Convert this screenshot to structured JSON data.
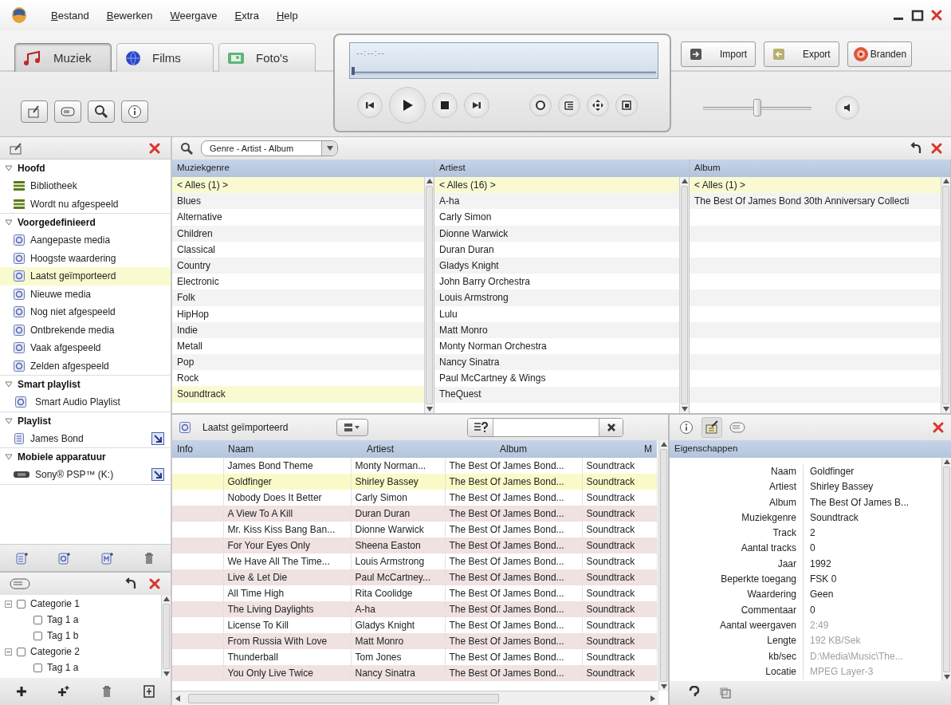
{
  "menu": [
    {
      "label": "Bestand"
    },
    {
      "label": "Bewerken"
    },
    {
      "label": "Weergave"
    },
    {
      "label": "Extra"
    },
    {
      "label": "Help"
    }
  ],
  "media_tabs": [
    {
      "label": "Muziek",
      "kind": "music",
      "selected": true
    },
    {
      "label": "Films",
      "kind": "film",
      "selected": false
    },
    {
      "label": "Foto's",
      "kind": "photo",
      "selected": false
    }
  ],
  "player": {
    "time": "--:--:--",
    "seek": {
      "level": 0
    },
    "volume": {
      "level": 0.5
    }
  },
  "actions": [
    {
      "label": "Import",
      "kind": "import"
    },
    {
      "label": "Export",
      "kind": "export"
    },
    {
      "label": "Branden",
      "kind": "burn"
    }
  ],
  "sidebar": {
    "sections": [
      {
        "title": "Hoofd",
        "items": [
          {
            "label": "Bibliotheek",
            "kind": "library",
            "selected": false
          },
          {
            "label": "Wordt nu afgespeeld",
            "kind": "library",
            "selected": false
          }
        ]
      },
      {
        "title": "Voorgedefinieerd",
        "items": [
          {
            "label": "Aangepaste media",
            "kind": "auto",
            "selected": false
          },
          {
            "label": "Hoogste waardering",
            "kind": "auto",
            "selected": false
          },
          {
            "label": "Laatst geïmporteerd",
            "kind": "auto",
            "selected": true
          },
          {
            "label": "Nieuwe media",
            "kind": "auto",
            "selected": false
          },
          {
            "label": "Nog niet afgespeeld",
            "kind": "auto",
            "selected": false
          },
          {
            "label": "Ontbrekende media",
            "kind": "auto",
            "selected": false
          },
          {
            "label": "Vaak afgespeeld",
            "kind": "auto",
            "selected": false
          },
          {
            "label": "Zelden afgespeeld",
            "kind": "auto",
            "selected": false
          }
        ]
      },
      {
        "title": "Smart playlist",
        "items": [
          {
            "label": "Smart Audio Playlist",
            "kind": "smart",
            "selected": false
          }
        ]
      },
      {
        "title": "Playlist",
        "items": [
          {
            "label": "James Bond",
            "kind": "playlist",
            "selected": false
          }
        ]
      },
      {
        "title": "Mobiele apparatuur",
        "items": [
          {
            "label": "Sony® PSP™ (K:)",
            "kind": "device",
            "selected": false
          }
        ]
      }
    ]
  },
  "tags": [
    {
      "label": "Categorie 1",
      "checked": false,
      "expanded": true,
      "children": [
        {
          "label": "Tag 1 a",
          "checked": false
        },
        {
          "label": "Tag 1 b",
          "checked": false
        }
      ]
    },
    {
      "label": "Categorie 2",
      "checked": false,
      "expanded": true,
      "children": [
        {
          "label": "Tag 1 a",
          "checked": false
        }
      ]
    }
  ],
  "browser": {
    "view": "Genre - Artist - Album",
    "columns": [
      {
        "title": "Muziekgenre",
        "items": [
          {
            "label": "< Alles (1) >",
            "selected": true
          },
          {
            "label": "Blues",
            "selected": false
          },
          {
            "label": "Alternative",
            "selected": false
          },
          {
            "label": "Children",
            "selected": false
          },
          {
            "label": "Classical",
            "selected": false
          },
          {
            "label": "Country",
            "selected": false
          },
          {
            "label": "Electronic",
            "selected": false
          },
          {
            "label": "Folk",
            "selected": false
          },
          {
            "label": "HipHop",
            "selected": false
          },
          {
            "label": "Indie",
            "selected": false
          },
          {
            "label": "Metall",
            "selected": false
          },
          {
            "label": "Pop",
            "selected": false
          },
          {
            "label": "Rock",
            "selected": false
          },
          {
            "label": "Soundtrack",
            "selected": true
          }
        ]
      },
      {
        "title": "Artiest",
        "items": [
          {
            "label": "< Alles (16) >",
            "selected": true
          },
          {
            "label": "A-ha",
            "selected": false
          },
          {
            "label": "Carly Simon",
            "selected": false
          },
          {
            "label": "Dionne Warwick",
            "selected": false
          },
          {
            "label": "Duran Duran",
            "selected": false
          },
          {
            "label": "Gladys Knight",
            "selected": false
          },
          {
            "label": "John Barry Orchestra",
            "selected": false
          },
          {
            "label": "Louis Armstrong",
            "selected": false
          },
          {
            "label": "Lulu",
            "selected": false
          },
          {
            "label": "Matt Monro",
            "selected": false
          },
          {
            "label": "Monty Norman Orchestra",
            "selected": false
          },
          {
            "label": "Nancy Sinatra",
            "selected": false
          },
          {
            "label": "Paul McCartney & Wings",
            "selected": false
          },
          {
            "label": "TheQuest",
            "selected": false
          }
        ]
      },
      {
        "title": "Album",
        "items": [
          {
            "label": "< Alles (1) >",
            "selected": true
          },
          {
            "label": "The Best Of James Bond 30th Anniversary Collecti",
            "selected": false
          }
        ]
      }
    ]
  },
  "playlist": {
    "title": "Laatst geïmporteerd",
    "columns": [
      "Info",
      "Naam",
      "Artiest",
      "Album",
      "M"
    ],
    "rows": [
      {
        "name": "James Bond Theme",
        "artist": "Monty Norman...",
        "album": "The Best Of James Bond...",
        "genre": "Soundtrack",
        "selected": false
      },
      {
        "name": "Goldfinger",
        "artist": "Shirley Bassey",
        "album": "The Best Of James Bond...",
        "genre": "Soundtrack",
        "selected": true
      },
      {
        "name": "Nobody Does It Better",
        "artist": "Carly Simon",
        "album": "The Best Of James Bond...",
        "genre": "Soundtrack",
        "selected": false
      },
      {
        "name": "A View To A Kill",
        "artist": "Duran Duran",
        "album": "The Best Of James Bond...",
        "genre": "Soundtrack",
        "selected": false
      },
      {
        "name": "Mr. Kiss Kiss Bang Ban...",
        "artist": "Dionne Warwick",
        "album": "The Best Of James Bond...",
        "genre": "Soundtrack",
        "selected": false
      },
      {
        "name": "For Your Eyes Only",
        "artist": "Sheena Easton",
        "album": "The Best Of James Bond...",
        "genre": "Soundtrack",
        "selected": false
      },
      {
        "name": "We Have All The Time...",
        "artist": "Louis Armstrong",
        "album": "The Best Of James Bond...",
        "genre": "Soundtrack",
        "selected": false
      },
      {
        "name": "Live & Let Die",
        "artist": "Paul McCartney...",
        "album": "The Best Of James Bond...",
        "genre": "Soundtrack",
        "selected": false
      },
      {
        "name": "All Time High",
        "artist": "Rita Coolidge",
        "album": "The Best Of James Bond...",
        "genre": "Soundtrack",
        "selected": false
      },
      {
        "name": "The Living Daylights",
        "artist": "A-ha",
        "album": "The Best Of James Bond...",
        "genre": "Soundtrack",
        "selected": false
      },
      {
        "name": "License To Kill",
        "artist": "Gladys Knight",
        "album": "The Best Of James Bond...",
        "genre": "Soundtrack",
        "selected": false
      },
      {
        "name": "From Russia With Love",
        "artist": "Matt Monro",
        "album": "The Best Of James Bond...",
        "genre": "Soundtrack",
        "selected": false
      },
      {
        "name": "Thunderball",
        "artist": "Tom Jones",
        "album": "The Best Of James Bond...",
        "genre": "Soundtrack",
        "selected": false
      },
      {
        "name": "You Only Live Twice",
        "artist": "Nancy Sinatra",
        "album": "The Best Of James Bond...",
        "genre": "Soundtrack",
        "selected": false
      }
    ]
  },
  "properties": {
    "tabs": [
      {
        "kind": "info",
        "selected": false
      },
      {
        "kind": "edit",
        "selected": true
      },
      {
        "kind": "tag",
        "selected": false
      }
    ],
    "title": "Eigenschappen",
    "fields": [
      {
        "label": "Naam",
        "value": "Goldfinger",
        "disabled": false
      },
      {
        "label": "Artiest",
        "value": "Shirley Bassey",
        "disabled": false
      },
      {
        "label": "Album",
        "value": "The Best Of James B...",
        "disabled": false
      },
      {
        "label": "Muziekgenre",
        "value": "Soundtrack",
        "disabled": false
      },
      {
        "label": "Track",
        "value": "2",
        "disabled": false
      },
      {
        "label": "Aantal tracks",
        "value": "0",
        "disabled": false
      },
      {
        "label": "Jaar",
        "value": "1992",
        "disabled": false
      },
      {
        "label": "Beperkte toegang",
        "value": "FSK 0",
        "disabled": false
      },
      {
        "label": "Waardering",
        "value": "Geen",
        "disabled": false
      },
      {
        "label": "Commentaar",
        "value": "0",
        "disabled": false
      },
      {
        "label": "Aantal weergaven",
        "value": "2:49",
        "disabled": true
      },
      {
        "label": "Lengte",
        "value": "192 KB/Sek",
        "disabled": true
      },
      {
        "label": "kb/sec",
        "value": "D:\\Media\\Music\\The...",
        "disabled": true
      },
      {
        "label": "Locatie",
        "value": "MPEG Layer-3",
        "disabled": true
      }
    ]
  }
}
